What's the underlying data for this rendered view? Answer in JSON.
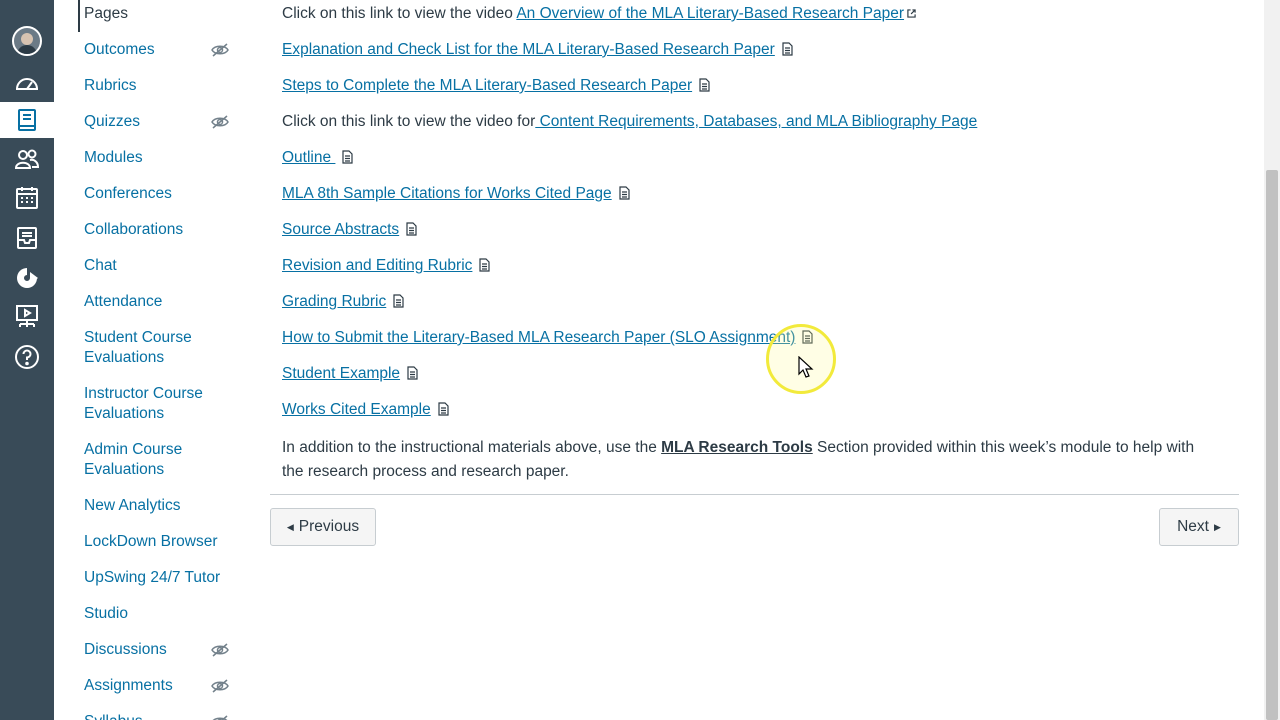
{
  "course_nav": {
    "items": [
      {
        "label": "Pages",
        "active": true,
        "hidden_from_students": false
      },
      {
        "label": "Outcomes",
        "hidden_from_students": true
      },
      {
        "label": "Rubrics",
        "hidden_from_students": false
      },
      {
        "label": "Quizzes",
        "hidden_from_students": true
      },
      {
        "label": "Modules",
        "hidden_from_students": false
      },
      {
        "label": "Conferences",
        "hidden_from_students": false
      },
      {
        "label": "Collaborations",
        "hidden_from_students": false
      },
      {
        "label": "Chat",
        "hidden_from_students": false
      },
      {
        "label": "Attendance",
        "hidden_from_students": false
      },
      {
        "label": "Student Course Evaluations",
        "hidden_from_students": false
      },
      {
        "label": "Instructor Course Evaluations",
        "hidden_from_students": false
      },
      {
        "label": "Admin Course Evaluations",
        "hidden_from_students": false
      },
      {
        "label": "New Analytics",
        "hidden_from_students": false
      },
      {
        "label": "LockDown Browser",
        "hidden_from_students": false
      },
      {
        "label": "UpSwing 24/7 Tutor",
        "hidden_from_students": false
      },
      {
        "label": "Studio",
        "hidden_from_students": false
      },
      {
        "label": "Discussions",
        "hidden_from_students": true
      },
      {
        "label": "Assignments",
        "hidden_from_students": true
      },
      {
        "label": "Syllabus",
        "hidden_from_students": true
      }
    ]
  },
  "global_nav": {
    "icons": [
      "account-avatar-icon",
      "dashboard-icon",
      "courses-icon",
      "groups-icon",
      "calendar-icon",
      "inbox-icon",
      "commons-icon",
      "studio-icon",
      "help-icon"
    ]
  },
  "content": {
    "row0": {
      "prefix": "Click on this link to view the video ",
      "link": "An Overview of the MLA Literary-Based Research Paper"
    },
    "row1": {
      "link": "Explanation and Check List for the MLA Literary-Based Research Paper"
    },
    "row2": {
      "link": "Steps to Complete the MLA Literary-Based Research Paper"
    },
    "row3": {
      "prefix": "Click on this link to view the video for",
      "link": " Content Requirements, Databases, and MLA Bibliography Page"
    },
    "row4": {
      "link": "Outline "
    },
    "row5": {
      "link": "MLA 8th Sample Citations for Works Cited Page"
    },
    "row6": {
      "link": "Source Abstracts"
    },
    "row7": {
      "link": "Revision and Editing Rubric"
    },
    "row8": {
      "link": "Grading Rubric"
    },
    "row9": {
      "link": "How to Submit the Literary-Based MLA Research Paper (SLO Assignment)"
    },
    "row10": {
      "link": "Student Example"
    },
    "row11": {
      "link": "Works Cited Example"
    },
    "paragraph": {
      "before": "In addition to the instructional materials above, use the  ",
      "link": "MLA Research Tools",
      "after": "   Section provided within this week’s module to help with the research process and research paper."
    }
  },
  "pagination": {
    "previous_label": "Previous",
    "next_label": "Next"
  },
  "colors": {
    "global_nav_bg": "#394b58",
    "link": "#0770a3",
    "text": "#2d3b45",
    "cursor_highlight": "#f2ea3b"
  }
}
